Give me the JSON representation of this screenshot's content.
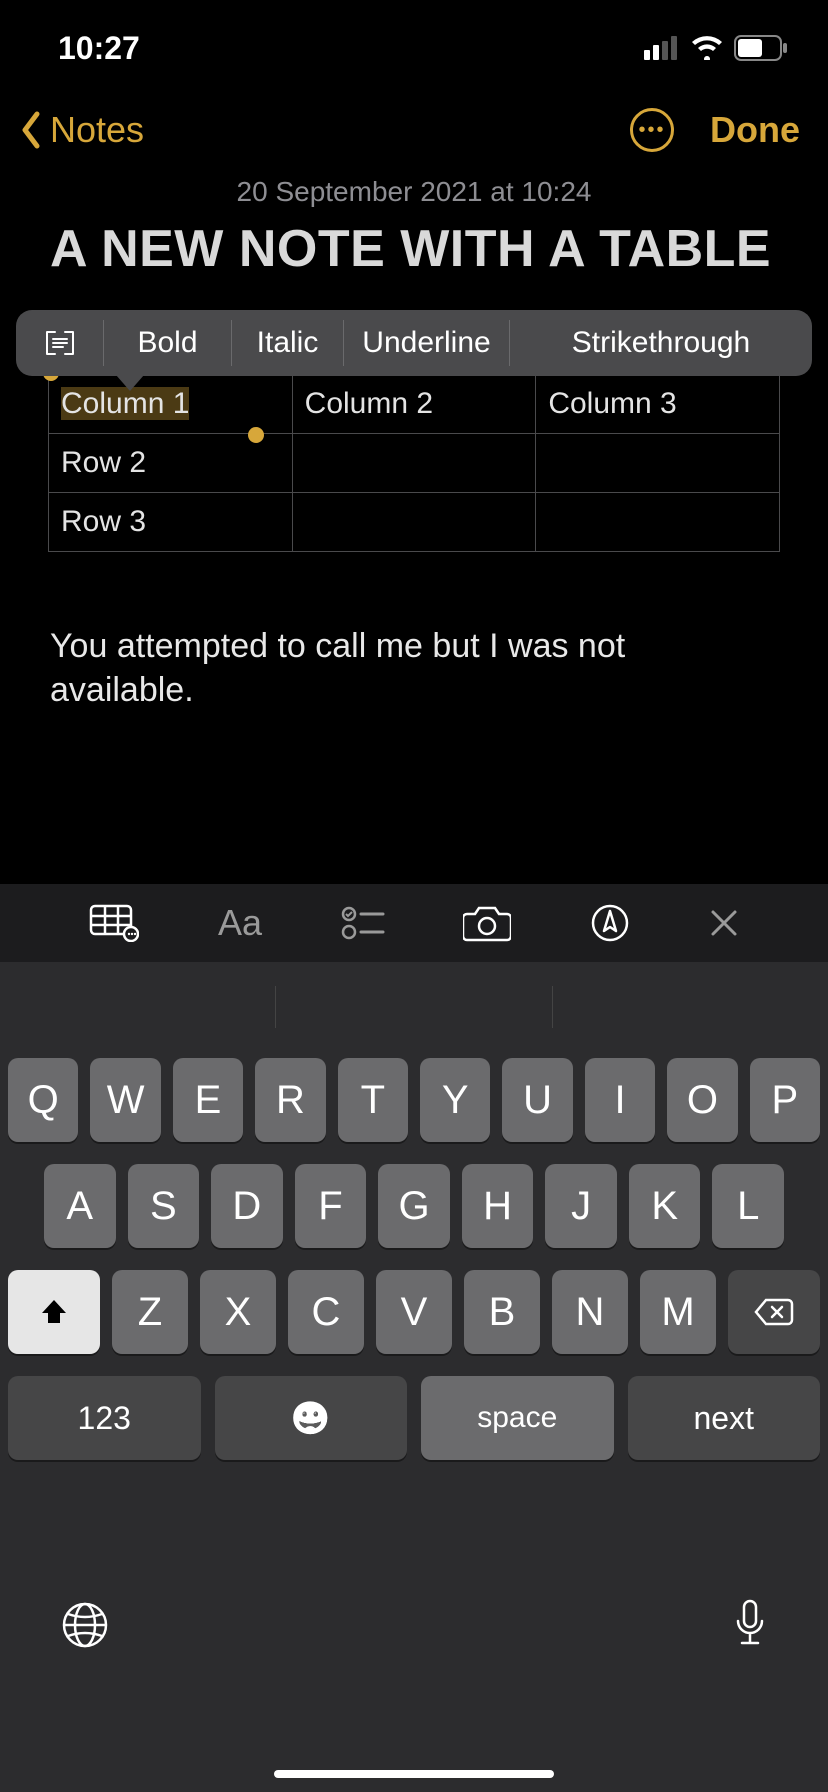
{
  "status": {
    "time": "10:27"
  },
  "nav": {
    "back_label": "Notes",
    "done_label": "Done"
  },
  "note": {
    "timestamp": "20 September 2021 at 10:24",
    "title": "A NEW NOTE WITH A TABLE",
    "body": "You attempted to call me but I was not available."
  },
  "format_menu": {
    "bold": "Bold",
    "italic": "Italic",
    "underline": "Underline",
    "strike": "Strikethrough"
  },
  "table": {
    "r0c0": "Column 1",
    "r0c1": "Column 2",
    "r0c2": "Column 3",
    "r1c0": "Row 2",
    "r2c0": "Row 3"
  },
  "format_toolbar": {
    "aa": "Aa"
  },
  "keyboard": {
    "row1": [
      "Q",
      "W",
      "E",
      "R",
      "T",
      "Y",
      "U",
      "I",
      "O",
      "P"
    ],
    "row2": [
      "A",
      "S",
      "D",
      "F",
      "G",
      "H",
      "J",
      "K",
      "L"
    ],
    "row3": [
      "Z",
      "X",
      "C",
      "V",
      "B",
      "N",
      "M"
    ],
    "numkey": "123",
    "space": "space",
    "next": "next"
  }
}
